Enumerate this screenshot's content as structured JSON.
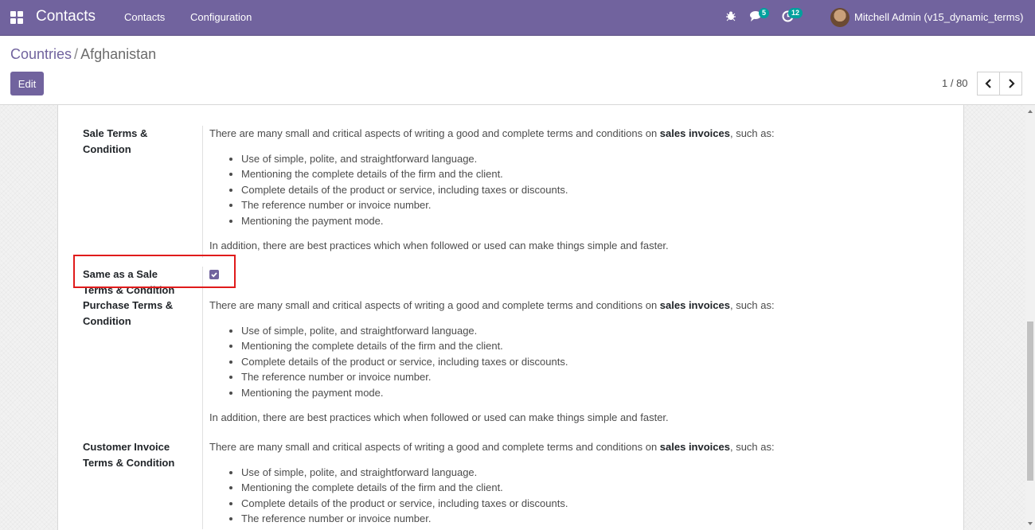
{
  "navbar": {
    "brand": "Contacts",
    "menu": [
      "Contacts",
      "Configuration"
    ],
    "messages_count": "5",
    "activities_count": "12",
    "user": "Mitchell Admin (v15_dynamic_terms)",
    "color": "#71639e"
  },
  "breadcrumb": {
    "parent": "Countries",
    "separator": "/",
    "current": "Afghanistan"
  },
  "toolbar": {
    "edit_label": "Edit",
    "pager": "1 / 80"
  },
  "form": {
    "sale_terms": {
      "label": "Sale Terms & Condition",
      "intro_before": "There are many small and critical aspects of writing a good and complete terms and conditions on ",
      "intro_bold": "sales invoices",
      "intro_after": ", such as:",
      "items": [
        "Use of simple, polite, and straightforward language.",
        "Mentioning the complete details of the firm and the client.",
        "Complete details of the product or service, including taxes or discounts.",
        "The reference number or invoice number.",
        "Mentioning the payment mode."
      ],
      "outro": "In addition, there are best practices which when followed or used can make things simple and faster."
    },
    "same_as_sale": {
      "label": "Same as a Sale Terms & Condition",
      "checked": true
    },
    "purchase_terms": {
      "label": "Purchase Terms & Condition",
      "intro_before": "There are many small and critical aspects of writing a good and complete terms and conditions on ",
      "intro_bold": "sales invoices",
      "intro_after": ", such as:",
      "items": [
        "Use of simple, polite, and straightforward language.",
        "Mentioning the complete details of the firm and the client.",
        "Complete details of the product or service, including taxes or discounts.",
        "The reference number or invoice number.",
        "Mentioning the payment mode."
      ],
      "outro": "In addition, there are best practices which when followed or used can make things simple and faster."
    },
    "customer_invoice_terms": {
      "label": "Customer Invoice Terms & Condition",
      "intro_before": "There are many small and critical aspects of writing a good and complete terms and conditions on ",
      "intro_bold": "sales invoices",
      "intro_after": ", such as:",
      "items": [
        "Use of simple, polite, and straightforward language.",
        "Mentioning the complete details of the firm and the client.",
        "Complete details of the product or service, including taxes or discounts.",
        "The reference number or invoice number."
      ]
    }
  },
  "annotation_color": "#e01b1b"
}
